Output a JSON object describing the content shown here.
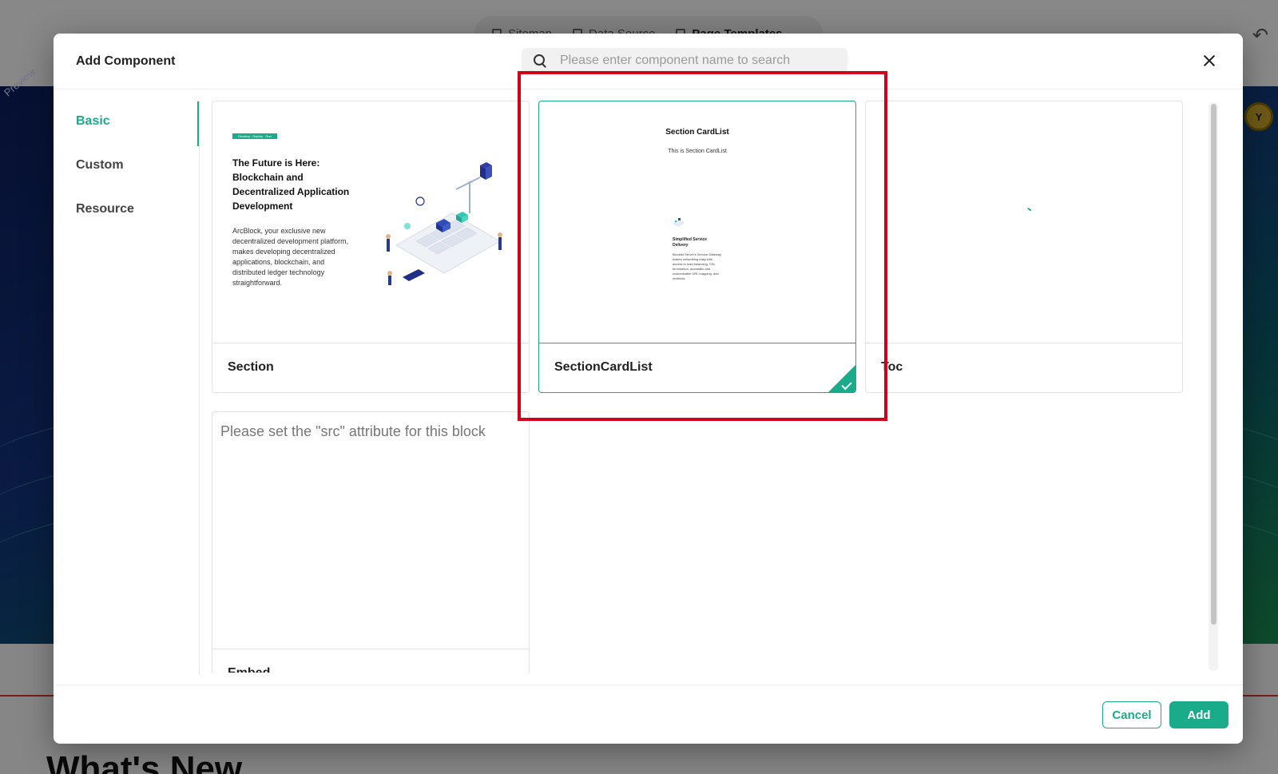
{
  "background": {
    "tabs": [
      {
        "label": "Sitemap"
      },
      {
        "label": "Data Source"
      },
      {
        "label": "Page Templates"
      }
    ],
    "preview_label": "Preview",
    "avatar_letter": "Y",
    "heading": "What's New"
  },
  "modal": {
    "title": "Add Component",
    "search": {
      "placeholder": "Please enter component name to search",
      "value": ""
    },
    "sidebar": {
      "items": [
        {
          "label": "Basic",
          "active": true
        },
        {
          "label": "Custom",
          "active": false
        },
        {
          "label": "Resource",
          "active": false
        }
      ]
    },
    "cards": [
      {
        "label": "Section",
        "selected": false,
        "preview": {
          "tag": "Develop · Deploy · Run",
          "title": "The Future is Here: Blockchain and Decentralized Application Development",
          "description": "ArcBlock, your exclusive new decentralized development platform, makes developing decentralized applications, blockchain, and distributed ledger technology straightforward."
        }
      },
      {
        "label": "SectionCardList",
        "selected": true,
        "preview": {
          "title": "Section CardList",
          "subtitle": "This is Section CardList",
          "card_title": "Simplified Service Delivery",
          "card_description": "Blocklet Server's Service Gateway makes networking easy with access to load balancing, SSL termination, automatic and customizable URL mapping, and redirects."
        }
      },
      {
        "label": "Toc",
        "selected": false
      }
    ],
    "block": {
      "message": "Please set the \"src\" attribute for this block",
      "label": "Embed"
    },
    "footer": {
      "cancel_label": "Cancel",
      "add_label": "Add"
    }
  },
  "colors": {
    "accent": "#1aab8b",
    "highlight": "#d0021b"
  }
}
